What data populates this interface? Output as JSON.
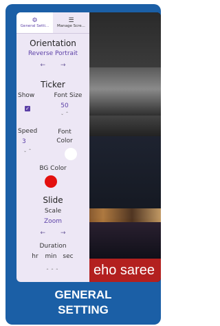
{
  "tabs": [
    {
      "label": "General Setti...",
      "icon": "gear-icon",
      "active": true
    },
    {
      "label": "Manage Scre...",
      "icon": "screens-icon",
      "active": false
    }
  ],
  "orientation": {
    "title": "Orientation",
    "value": "Reverse Portrait",
    "prev": "←",
    "next": "→"
  },
  "ticker": {
    "title": "Ticker",
    "show_label": "Show",
    "font_size_label": "Font Size",
    "font_size_value": "50",
    "speed_label": "Speed",
    "speed_value": "3",
    "font_color_label": "Font Color",
    "font_color": "#ffffff",
    "bg_color_label": "BG Color",
    "bg_color": "#e3100f"
  },
  "slide": {
    "title": "Slide",
    "scale_label": "Scale",
    "scale_value": "Zoom",
    "prev": "←",
    "next": "→",
    "duration_label": "Duration",
    "hr_label": "hr",
    "min_label": "min",
    "sec_label": "sec"
  },
  "ticker_preview_text": "eho saree",
  "caption": "GENERAL SETTING",
  "colors": {
    "card": "#1b5fa6",
    "panel": "#ede7f5",
    "accent": "#5b3fa6"
  }
}
